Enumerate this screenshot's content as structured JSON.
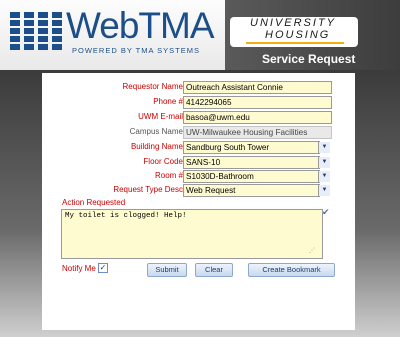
{
  "header": {
    "brand": "WebTMA",
    "brand_sub": "POWERED BY TMA SYSTEMS",
    "partner_line1": "UNIVERSITY",
    "partner_line2": "HOUSING",
    "title": "Service Request"
  },
  "form": {
    "requestor_name": {
      "label": "Requestor Name",
      "value": "Outreach Assistant Connie"
    },
    "phone": {
      "label": "Phone #",
      "value": "4142294065"
    },
    "email": {
      "label": "UWM E-mail",
      "value": "basoa@uwm.edu"
    },
    "campus": {
      "label": "Campus Name",
      "value": "UW-Milwaukee Housing Facilities"
    },
    "building": {
      "label": "Building Name",
      "value": "Sandburg South Tower"
    },
    "floor": {
      "label": "Floor Code",
      "value": "SANS-10"
    },
    "room": {
      "label": "Room #",
      "value": "S1030D-Bathroom"
    },
    "request_type": {
      "label": "Request Type Desc",
      "value": "Web Request"
    },
    "action_label": "Action Requested",
    "action_text": "My toilet is clogged!  Help!",
    "notify_label": "Notify Me",
    "notify_checked": true
  },
  "buttons": {
    "submit": "Submit",
    "clear": "Clear",
    "bookmark": "Create Bookmark"
  },
  "colors": {
    "brand_blue": "#1c4f8a",
    "required_red": "#cc0000",
    "field_yellow": "#fffbd0",
    "accent_gold": "#f0b010"
  }
}
